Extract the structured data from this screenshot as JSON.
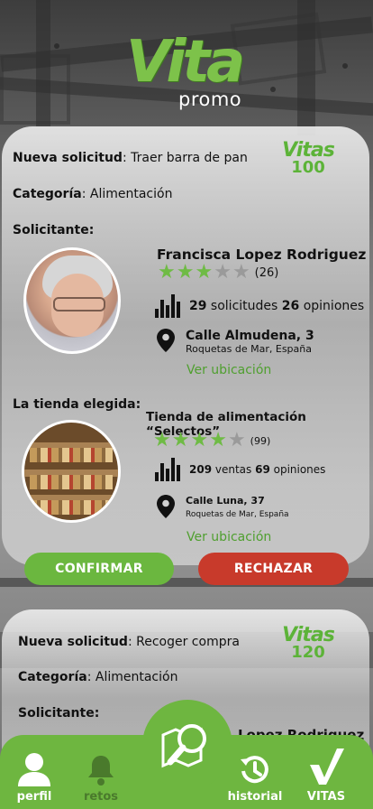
{
  "logo": {
    "main": "Vita",
    "sub": "promo"
  },
  "requests": [
    {
      "title_label": "Nueva solicitud",
      "title_value": ": Traer barra de pan",
      "category_label": "Categoría",
      "category_value": ": Alimentación",
      "requester_label": "Solicitante:",
      "vitas_label": "Vitas",
      "vitas_amount": "100",
      "requester": {
        "name": "Francisca Lopez Rodriguez",
        "rating": 3,
        "rating_max": 5,
        "reviews": "(26)",
        "solicitudes_count": "29",
        "solicitudes_label": " solicitudes ",
        "opiniones_count": "26",
        "opiniones_label": " opiniones",
        "street": "Calle Almudena, 3",
        "city": "Roquetas de Mar, España",
        "map_link": "Ver ubicación"
      },
      "store_label": "La tienda elegida:",
      "store": {
        "name": "Tienda de alimentación “Selectos”",
        "rating": 4,
        "rating_max": 5,
        "reviews": "(99)",
        "ventas_count": "209",
        "ventas_label": " ventas ",
        "opiniones_count": "69",
        "opiniones_label": " opiniones",
        "street": "Calle Luna, 37",
        "city": "Roquetas de Mar, España",
        "map_link": "Ver ubicación"
      },
      "confirm_label": "CONFIRMAR",
      "reject_label": "RECHAZAR"
    },
    {
      "title_label": "Nueva solicitud",
      "title_value": ": Recoger compra",
      "category_label": "Categoría",
      "category_value": ": Alimentación",
      "requester_label": "Solicitante:",
      "vitas_label": "Vitas",
      "vitas_amount": "120",
      "requester_name_partial": "Lopez Rodriguez"
    }
  ],
  "nav": {
    "perfil": "perfil",
    "retos": "retos",
    "historial": "historial",
    "vitas": "VITAS"
  },
  "icons": {
    "perfil": "user-icon",
    "retos": "bell-icon",
    "center": "map-search-icon",
    "historial": "history-icon",
    "vitas": "checkmark-icon"
  },
  "colors": {
    "accent": "#6eb640",
    "reject": "#c83a2b",
    "link": "#4f9f2f"
  }
}
